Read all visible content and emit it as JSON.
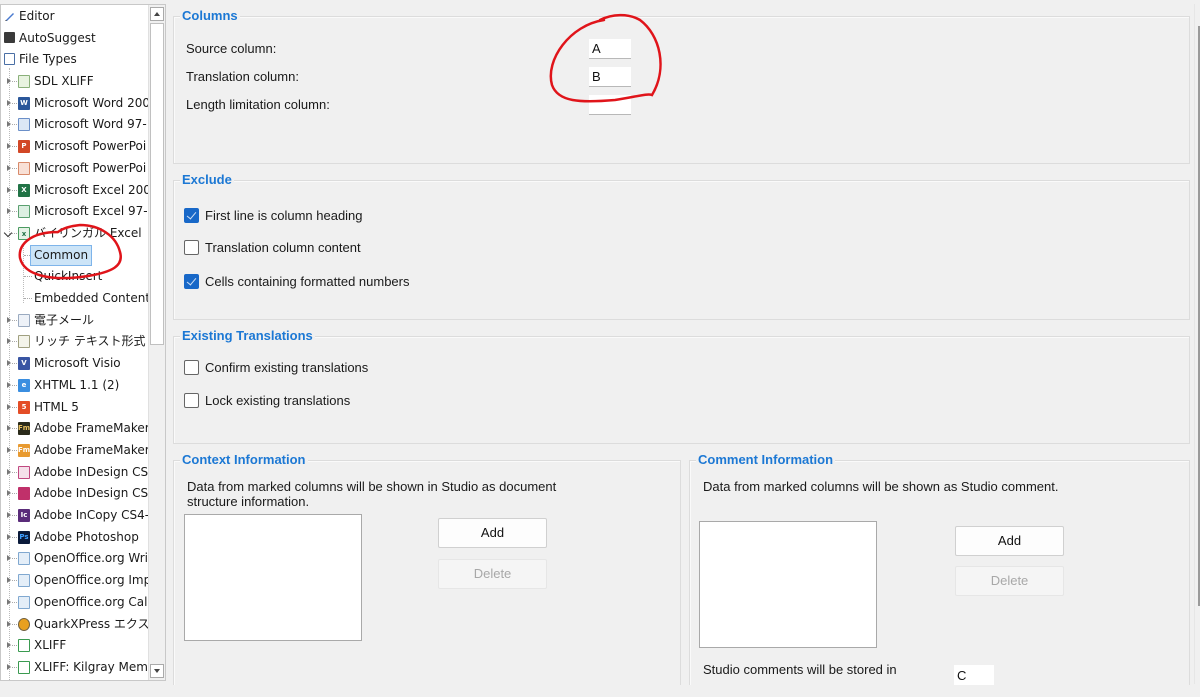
{
  "tree": {
    "items": [
      {
        "label": "Editor",
        "icon": "pencil-icon",
        "level": 0
      },
      {
        "label": "AutoSuggest",
        "icon": "autosuggest-icon",
        "level": 0
      },
      {
        "label": "File Types",
        "icon": "file-types-icon",
        "level": 0
      },
      {
        "label": "SDL XLIFF",
        "icon": "sdl-xliff-icon",
        "level": 1
      },
      {
        "label": "Microsoft Word 200",
        "icon": "word-icon",
        "level": 1
      },
      {
        "label": "Microsoft Word 97-",
        "icon": "word-legacy-icon",
        "level": 1
      },
      {
        "label": "Microsoft PowerPoi",
        "icon": "powerpoint-icon",
        "level": 1
      },
      {
        "label": "Microsoft PowerPoi",
        "icon": "powerpoint-legacy-icon",
        "level": 1
      },
      {
        "label": "Microsoft Excel 200",
        "icon": "excel-icon",
        "level": 1
      },
      {
        "label": "Microsoft Excel 97-",
        "icon": "excel-legacy-icon",
        "level": 1
      },
      {
        "label": "バイリンガル Excel",
        "icon": "bilingual-excel-icon",
        "level": 1,
        "expanded": true
      },
      {
        "label": "Common",
        "level": 2,
        "selected": true
      },
      {
        "label": "QuickInsert",
        "level": 2
      },
      {
        "label": "Embedded Content",
        "level": 2
      },
      {
        "label": "電子メール",
        "icon": "email-icon",
        "level": 1
      },
      {
        "label": "リッチ テキスト形式 (R",
        "icon": "rtf-icon",
        "level": 1
      },
      {
        "label": "Microsoft Visio",
        "icon": "visio-icon",
        "level": 1
      },
      {
        "label": "XHTML 1.1 (2)",
        "icon": "xhtml-icon",
        "level": 1
      },
      {
        "label": "HTML 5",
        "icon": "html5-icon",
        "level": 1
      },
      {
        "label": "Adobe FrameMaker",
        "icon": "framemaker-icon",
        "level": 1
      },
      {
        "label": "Adobe FrameMaker",
        "icon": "framemaker-mif-icon",
        "level": 1
      },
      {
        "label": "Adobe InDesign CS",
        "icon": "indesign-icon",
        "level": 1
      },
      {
        "label": "Adobe InDesign CS",
        "icon": "indesign-idml-icon",
        "level": 1
      },
      {
        "label": "Adobe InCopy CS4-",
        "icon": "incopy-icon",
        "level": 1
      },
      {
        "label": "Adobe Photoshop",
        "icon": "photoshop-icon",
        "level": 1
      },
      {
        "label": "OpenOffice.org Wri",
        "icon": "openoffice-writer-icon",
        "level": 1
      },
      {
        "label": "OpenOffice.org Imp",
        "icon": "openoffice-impress-icon",
        "level": 1
      },
      {
        "label": "OpenOffice.org Cal",
        "icon": "openoffice-calc-icon",
        "level": 1
      },
      {
        "label": "QuarkXPress エクス",
        "icon": "quarkxpress-icon",
        "level": 1
      },
      {
        "label": "XLIFF",
        "icon": "xliff-icon",
        "level": 1
      },
      {
        "label": "XLIFF: Kilgray Mem",
        "icon": "xliff-kilgray-icon",
        "level": 1
      }
    ]
  },
  "columns": {
    "title": "Columns",
    "source_label": "Source column:",
    "source_value": "A",
    "translation_label": "Translation column:",
    "translation_value": "B",
    "length_label": "Length limitation column:",
    "length_value": ""
  },
  "exclude": {
    "title": "Exclude",
    "options": [
      {
        "label": "First line is column heading",
        "checked": true
      },
      {
        "label": "Translation column content",
        "checked": false
      },
      {
        "label": "Cells containing formatted numbers",
        "checked": true
      }
    ]
  },
  "existing": {
    "title": "Existing Translations",
    "options": [
      {
        "label": "Confirm existing translations",
        "checked": false
      },
      {
        "label": "Lock existing translations",
        "checked": false
      }
    ]
  },
  "context": {
    "title": "Context Information",
    "description": "Data from marked columns will be shown in Studio as document structure information.",
    "add_label": "Add",
    "delete_label": "Delete"
  },
  "comment": {
    "title": "Comment Information",
    "description": "Data from marked columns will be shown as Studio comment.",
    "add_label": "Add",
    "delete_label": "Delete",
    "stored_label": "Studio comments will be stored in",
    "stored_value": "C"
  },
  "colors": {
    "accent": "#1c78d4",
    "annotation": "#e0141a",
    "checkbox_on": "#1868c8"
  }
}
